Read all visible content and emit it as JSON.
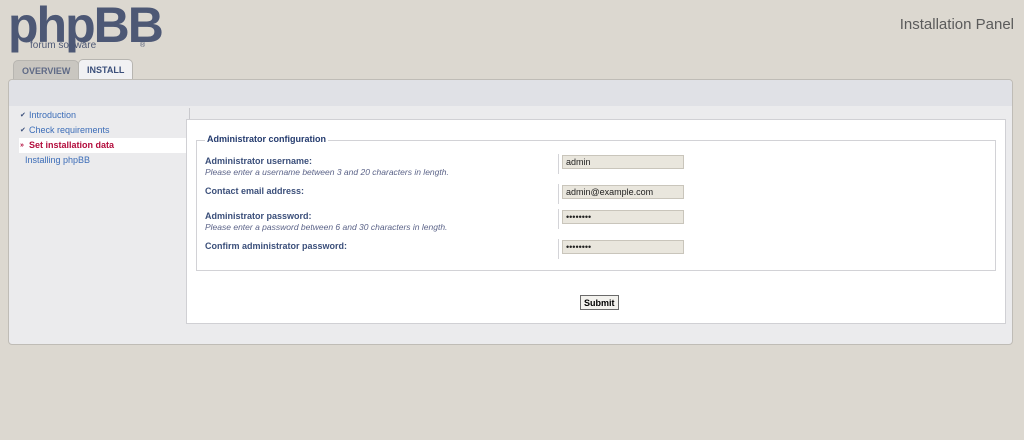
{
  "brand": {
    "logo_text": "phpBB",
    "logo_subtitle": "forum software",
    "registered_mark": "®"
  },
  "header": {
    "panel_title": "Installation Panel"
  },
  "tabs": [
    {
      "label": "OVERVIEW",
      "active": false
    },
    {
      "label": "INSTALL",
      "active": true
    }
  ],
  "sidebar": {
    "items": [
      {
        "label": "Introduction",
        "marker": "✔",
        "state": "done"
      },
      {
        "label": "Check requirements",
        "marker": "✔",
        "state": "done"
      },
      {
        "label": "Set installation data",
        "marker": "»",
        "state": "active"
      },
      {
        "label": "Installing phpBB",
        "marker": "",
        "state": "pending"
      }
    ]
  },
  "form": {
    "legend": "Administrator configuration",
    "fields": [
      {
        "label": "Administrator username:",
        "hint": "Please enter a username between 3 and 20 characters in length.",
        "value": "admin",
        "type": "text"
      },
      {
        "label": "Contact email address:",
        "hint": "",
        "value": "admin@example.com",
        "type": "text"
      },
      {
        "label": "Administrator password:",
        "hint": "Please enter a password between 6 and 30 characters in length.",
        "value": "password",
        "type": "password"
      },
      {
        "label": "Confirm administrator password:",
        "hint": "",
        "value": "password",
        "type": "password"
      }
    ],
    "submit_label": "Submit"
  }
}
